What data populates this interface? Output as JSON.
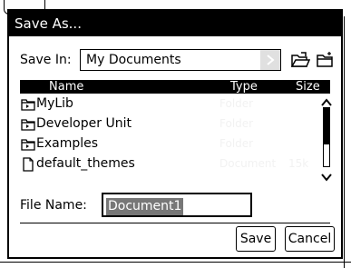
{
  "dialog": {
    "title": "Save As...",
    "save_in": {
      "label": "Save In:",
      "value": "My Documents"
    },
    "toolbar": {
      "icons": [
        "open-folder-icon",
        "new-folder-icon"
      ]
    },
    "list": {
      "columns": [
        "Name",
        "Type",
        "Size"
      ],
      "items": [
        {
          "name": "MyLib",
          "type": "Folder",
          "size": "",
          "icon": "folder-icon"
        },
        {
          "name": "Developer Unit",
          "type": "Folder",
          "size": "",
          "icon": "folder-icon"
        },
        {
          "name": "Examples",
          "type": "Folder",
          "size": "",
          "icon": "folder-icon"
        },
        {
          "name": "default_themes",
          "type": "Document",
          "size": "15k",
          "icon": "document-icon"
        }
      ]
    },
    "file_name": {
      "label": "File Name:",
      "value": "Document1"
    },
    "buttons": {
      "save": "Save",
      "cancel": "Cancel"
    }
  },
  "colors": {
    "titlebar": "#000000",
    "selection": "#777777",
    "faded_text": "#f2f2f2"
  }
}
